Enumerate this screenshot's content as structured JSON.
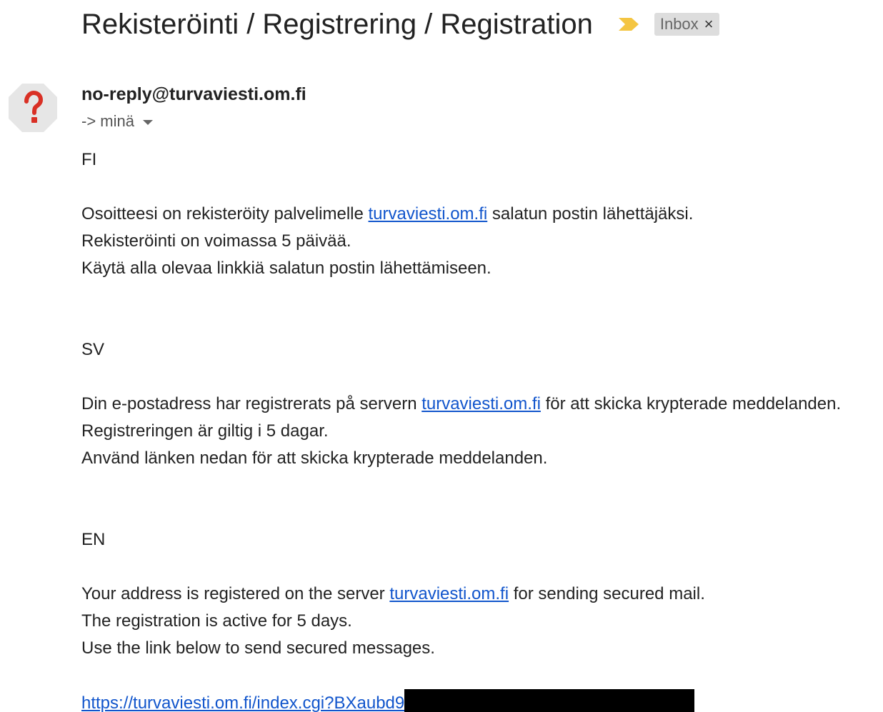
{
  "email": {
    "subject": "Rekisteröinti / Registrering / Registration",
    "label": "Inbox",
    "label_close": "×",
    "sender": "no-reply@turvaviesti.om.fi",
    "recipient": "-> minä"
  },
  "icons": {
    "avatar": "unknown-sender-question-icon",
    "importance": "importance-marker-icon",
    "recipient_details": "chevron-down-icon"
  },
  "colors": {
    "link": "#1155cc",
    "importance": "#f4c542",
    "avatar_bg": "#e6e6e6",
    "avatar_mark": "#d93025",
    "chip_bg": "#dddddd"
  },
  "body": {
    "fi": {
      "heading": "FI",
      "line1_before": "Osoitteesi on rekisteröity palvelimelle ",
      "line1_link": "turvaviesti.om.fi",
      "line1_after": " salatun postin lähettäjäksi.",
      "line2": "Rekisteröinti on voimassa 5 päivää.",
      "line3": "Käytä alla olevaa linkkiä salatun postin lähettämiseen."
    },
    "sv": {
      "heading": "SV",
      "line1_before": "Din e-postadress har registrerats på servern ",
      "line1_link": "turvaviesti.om.fi",
      "line1_after": " för att skicka krypterade meddelanden.",
      "line2": "Registreringen är giltig i 5 dagar.",
      "line3": "Använd länken nedan för att skicka krypterade meddelanden."
    },
    "en": {
      "heading": "EN",
      "line1_before": "Your address is registered on the server ",
      "line1_link": "turvaviesti.om.fi",
      "line1_after": " for sending secured mail.",
      "line2": "The registration is active for 5 days.",
      "line3": "Use the link below to send secured messages."
    },
    "registration_link": "https://turvaviesti.om.fi/index.cgi?BXaubd9"
  }
}
